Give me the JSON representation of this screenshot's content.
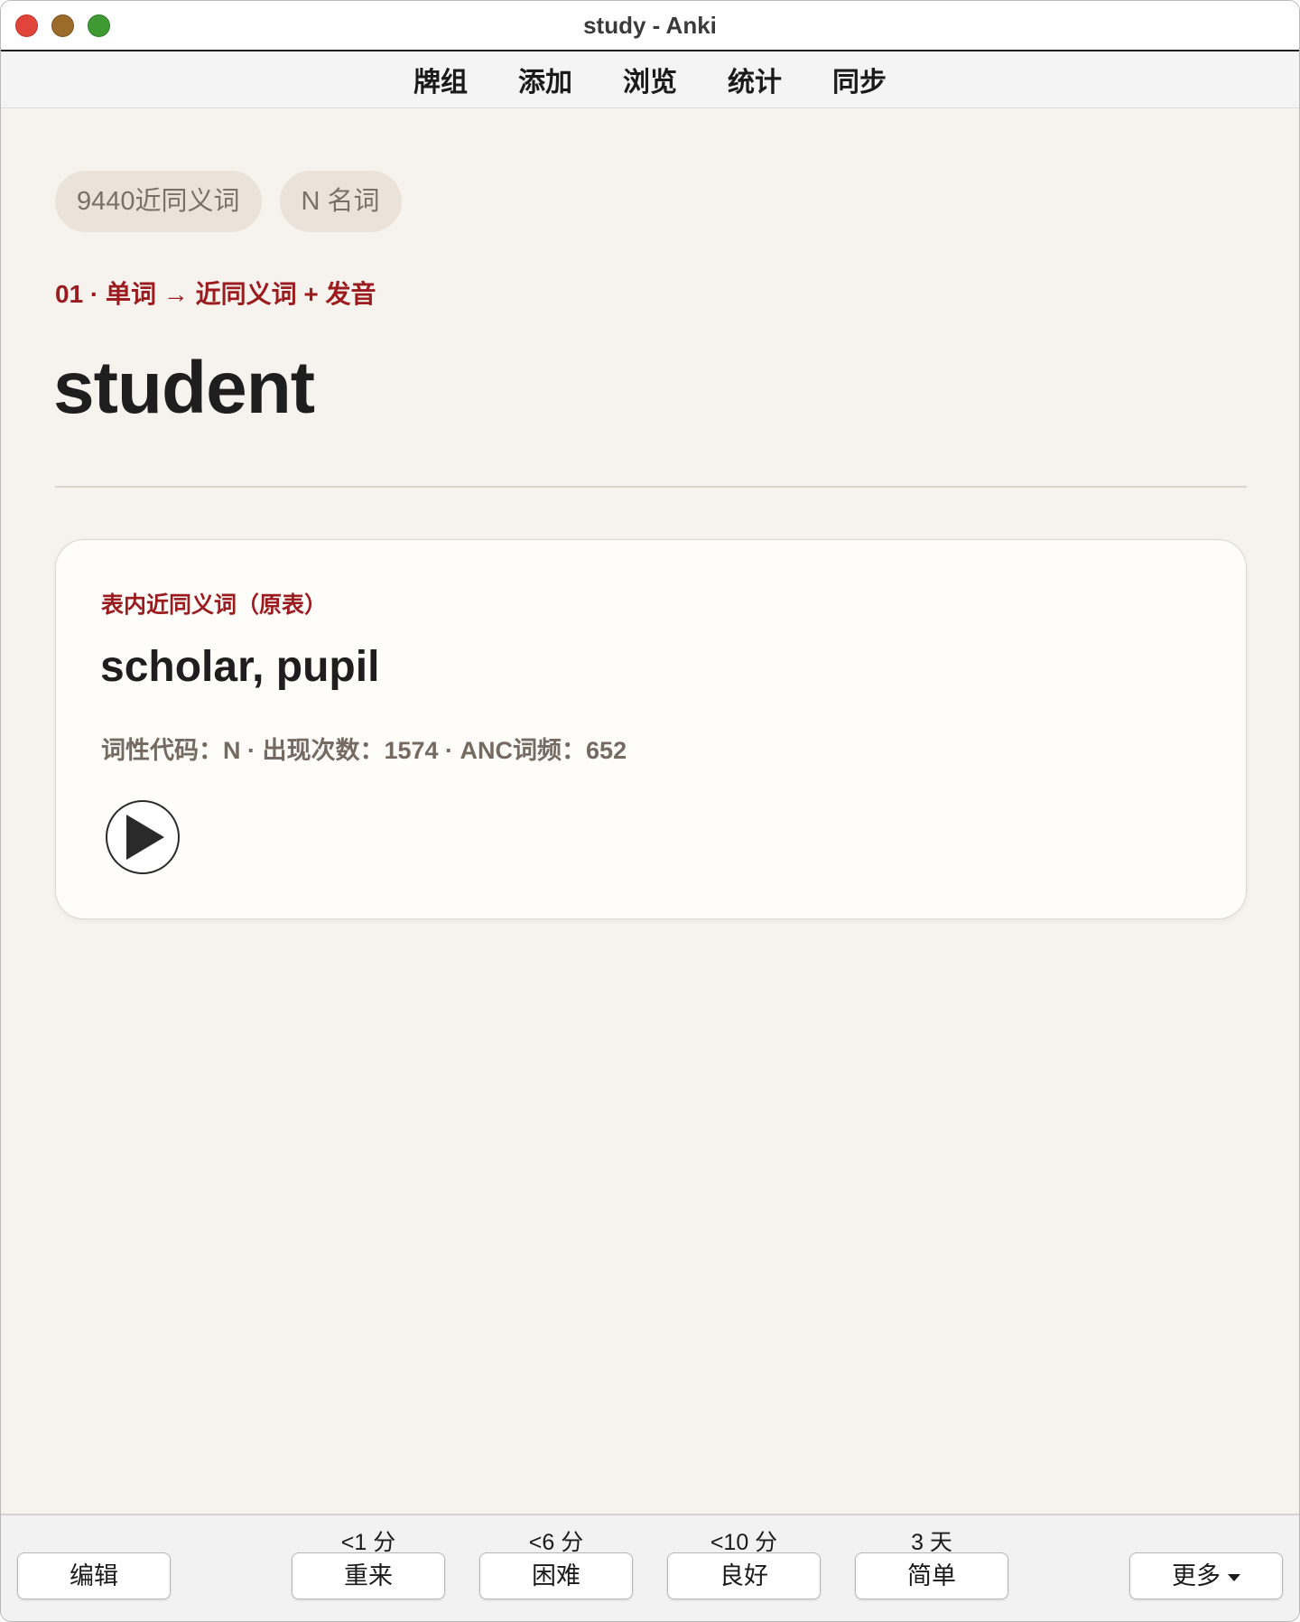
{
  "window": {
    "title": "study - Anki"
  },
  "menu": {
    "items": [
      "牌组",
      "添加",
      "浏览",
      "统计",
      "同步"
    ]
  },
  "tags": [
    "9440近同义词",
    "N 名词"
  ],
  "card_type": "01 · 单词 → 近同义词 + 发音",
  "headword": "student",
  "answer_card": {
    "label": "表内近同义词（原表）",
    "synonyms": "scholar, pupil",
    "meta": "词性代码：N · 出现次数：1574 · ANC词频：652",
    "play_icon": "play-icon"
  },
  "bottom_bar": {
    "edit_label": "编辑",
    "more_label": "更多",
    "answers": [
      {
        "interval": "<1 分",
        "label": "重来"
      },
      {
        "interval": "<6 分",
        "label": "困难"
      },
      {
        "interval": "<10 分",
        "label": "良好"
      },
      {
        "interval": "3 天",
        "label": "简单"
      }
    ]
  },
  "colors": {
    "accent_red": "#9b1b1e",
    "background": "#f6f2ed",
    "card_bg": "#fefdf9",
    "tag_bg": "#ebe3d9"
  }
}
